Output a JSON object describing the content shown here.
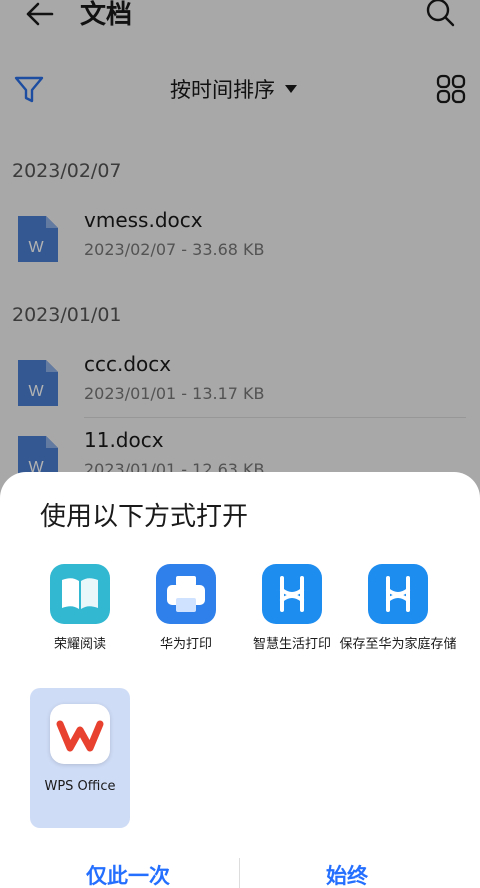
{
  "header": {
    "title": "文档",
    "back_icon": "arrow-left-icon",
    "search_icon": "search-icon"
  },
  "toolbar": {
    "filter_icon": "filter-icon",
    "sort_label": "按时间排序",
    "grid_icon": "grid-view-icon",
    "accent": "#2a6fe6"
  },
  "groups": [
    {
      "date": "2023/02/07",
      "files": [
        {
          "name": "vmess.docx",
          "meta": "2023/02/07 - 33.68 KB"
        }
      ]
    },
    {
      "date": "2023/01/01",
      "files": [
        {
          "name": "ccc.docx",
          "meta": "2023/01/01 - 13.17 KB"
        },
        {
          "name": "11.docx",
          "meta": "2023/01/01 - 12.63 KB"
        }
      ]
    }
  ],
  "sheet": {
    "title": "使用以下方式打开",
    "apps": [
      {
        "label": "荣耀阅读",
        "icon": "book-reader-icon",
        "color": "#33b8d2"
      },
      {
        "label": "华为打印",
        "icon": "printer-icon",
        "color": "#2f80ea"
      },
      {
        "label": "智慧生活打印",
        "icon": "hilink-icon",
        "color": "#1e8df0"
      },
      {
        "label": "保存至华为家庭存储",
        "icon": "hilink-icon",
        "color": "#1e8df0"
      },
      {
        "label": "WPS Office",
        "icon": "wps-office-icon",
        "color": "#e8412f"
      }
    ],
    "selected_app": "WPS Office"
  },
  "footer": {
    "once_label": "仅此一次",
    "always_label": "始终",
    "accent": "#256fff"
  }
}
